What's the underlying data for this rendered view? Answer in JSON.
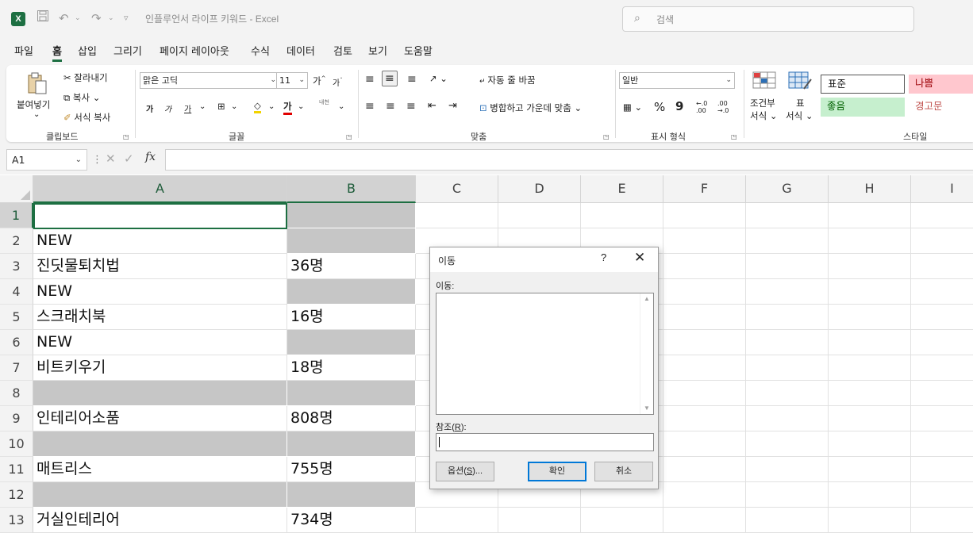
{
  "titlebar": {
    "app_icon": "X",
    "save_icon": "save-icon",
    "undo_icon": "undo-icon",
    "redo_icon": "redo-icon",
    "doc_title": "인플루언서 라이프 키워드 - Excel",
    "search_placeholder": "검색"
  },
  "menu": [
    "파일",
    "홈",
    "삽입",
    "그리기",
    "페이지 레이아웃",
    "수식",
    "데이터",
    "검토",
    "보기",
    "도움말"
  ],
  "ribbon": {
    "clipboard": {
      "paste": "붙여넣기",
      "cut": "잘라내기",
      "copy": "복사",
      "format_painter": "서식 복사",
      "label": "클립보드"
    },
    "font": {
      "name": "맑은 고딕",
      "size": "11",
      "grow": "가",
      "shrink": "가",
      "bold": "가",
      "italic": "가",
      "underline": "가",
      "font_color": "가",
      "phonetic": "내천",
      "label": "글꼴"
    },
    "align": {
      "wrap": "자동 줄 바꿈",
      "merge": "병합하고 가운데 맞춤",
      "label": "맞춤"
    },
    "number": {
      "format": "일반",
      "percent": "%",
      "comma": "9",
      "inc_decimal": "←.0 .00",
      "dec_decimal": ".00 →.0",
      "label": "표시 형식"
    },
    "styles": {
      "conditional_line1": "조건부",
      "conditional_line2": "서식",
      "table_line1": "표",
      "table_line2": "서식",
      "normal": "표준",
      "bad": "나쁨",
      "good": "좋음",
      "warning": "경고문",
      "label": "스타일"
    }
  },
  "formula_bar": {
    "name_box": "A1",
    "fx": "fx",
    "value": ""
  },
  "columns": [
    "A",
    "B",
    "C",
    "D",
    "E",
    "F",
    "G",
    "H",
    "I"
  ],
  "rows": [
    {
      "num": "1",
      "a": "",
      "b": "",
      "gray_b": true,
      "gray_a": false
    },
    {
      "num": "2",
      "a": "NEW",
      "b": "",
      "gray_b": true,
      "gray_a": false
    },
    {
      "num": "3",
      "a": "진딧물퇴치법",
      "b": "36명",
      "gray_b": false,
      "gray_a": false
    },
    {
      "num": "4",
      "a": "NEW",
      "b": "",
      "gray_b": true,
      "gray_a": false
    },
    {
      "num": "5",
      "a": "스크래치북",
      "b": "16명",
      "gray_b": false,
      "gray_a": false
    },
    {
      "num": "6",
      "a": "NEW",
      "b": "",
      "gray_b": true,
      "gray_a": false
    },
    {
      "num": "7",
      "a": "비트키우기",
      "b": "18명",
      "gray_b": false,
      "gray_a": false
    },
    {
      "num": "8",
      "a": "",
      "b": "",
      "gray_b": true,
      "gray_a": true
    },
    {
      "num": "9",
      "a": "인테리어소품",
      "b": "808명",
      "gray_b": false,
      "gray_a": false
    },
    {
      "num": "10",
      "a": "",
      "b": "",
      "gray_b": true,
      "gray_a": true
    },
    {
      "num": "11",
      "a": "매트리스",
      "b": "755명",
      "gray_b": false,
      "gray_a": false
    },
    {
      "num": "12",
      "a": "",
      "b": "",
      "gray_b": true,
      "gray_a": true
    },
    {
      "num": "13",
      "a": "거실인테리어",
      "b": "734명",
      "gray_b": false,
      "gray_a": false
    }
  ],
  "dialog": {
    "title": "이동",
    "help": "?",
    "close": "✕",
    "goto_label": "이동:",
    "ref_label": "참조(",
    "ref_key": "R",
    "ref_end": "):",
    "ref_value": "",
    "options_label": "옵션(",
    "options_key": "S",
    "options_end": ")...",
    "ok": "확인",
    "cancel": "취소"
  },
  "colors": {
    "accent": "#1d6f42",
    "gray_fill": "#c6c6c6",
    "bad_bg": "#ffc7ce",
    "bad_fg": "#9c0006",
    "good_bg": "#c6efce",
    "good_fg": "#006100"
  }
}
